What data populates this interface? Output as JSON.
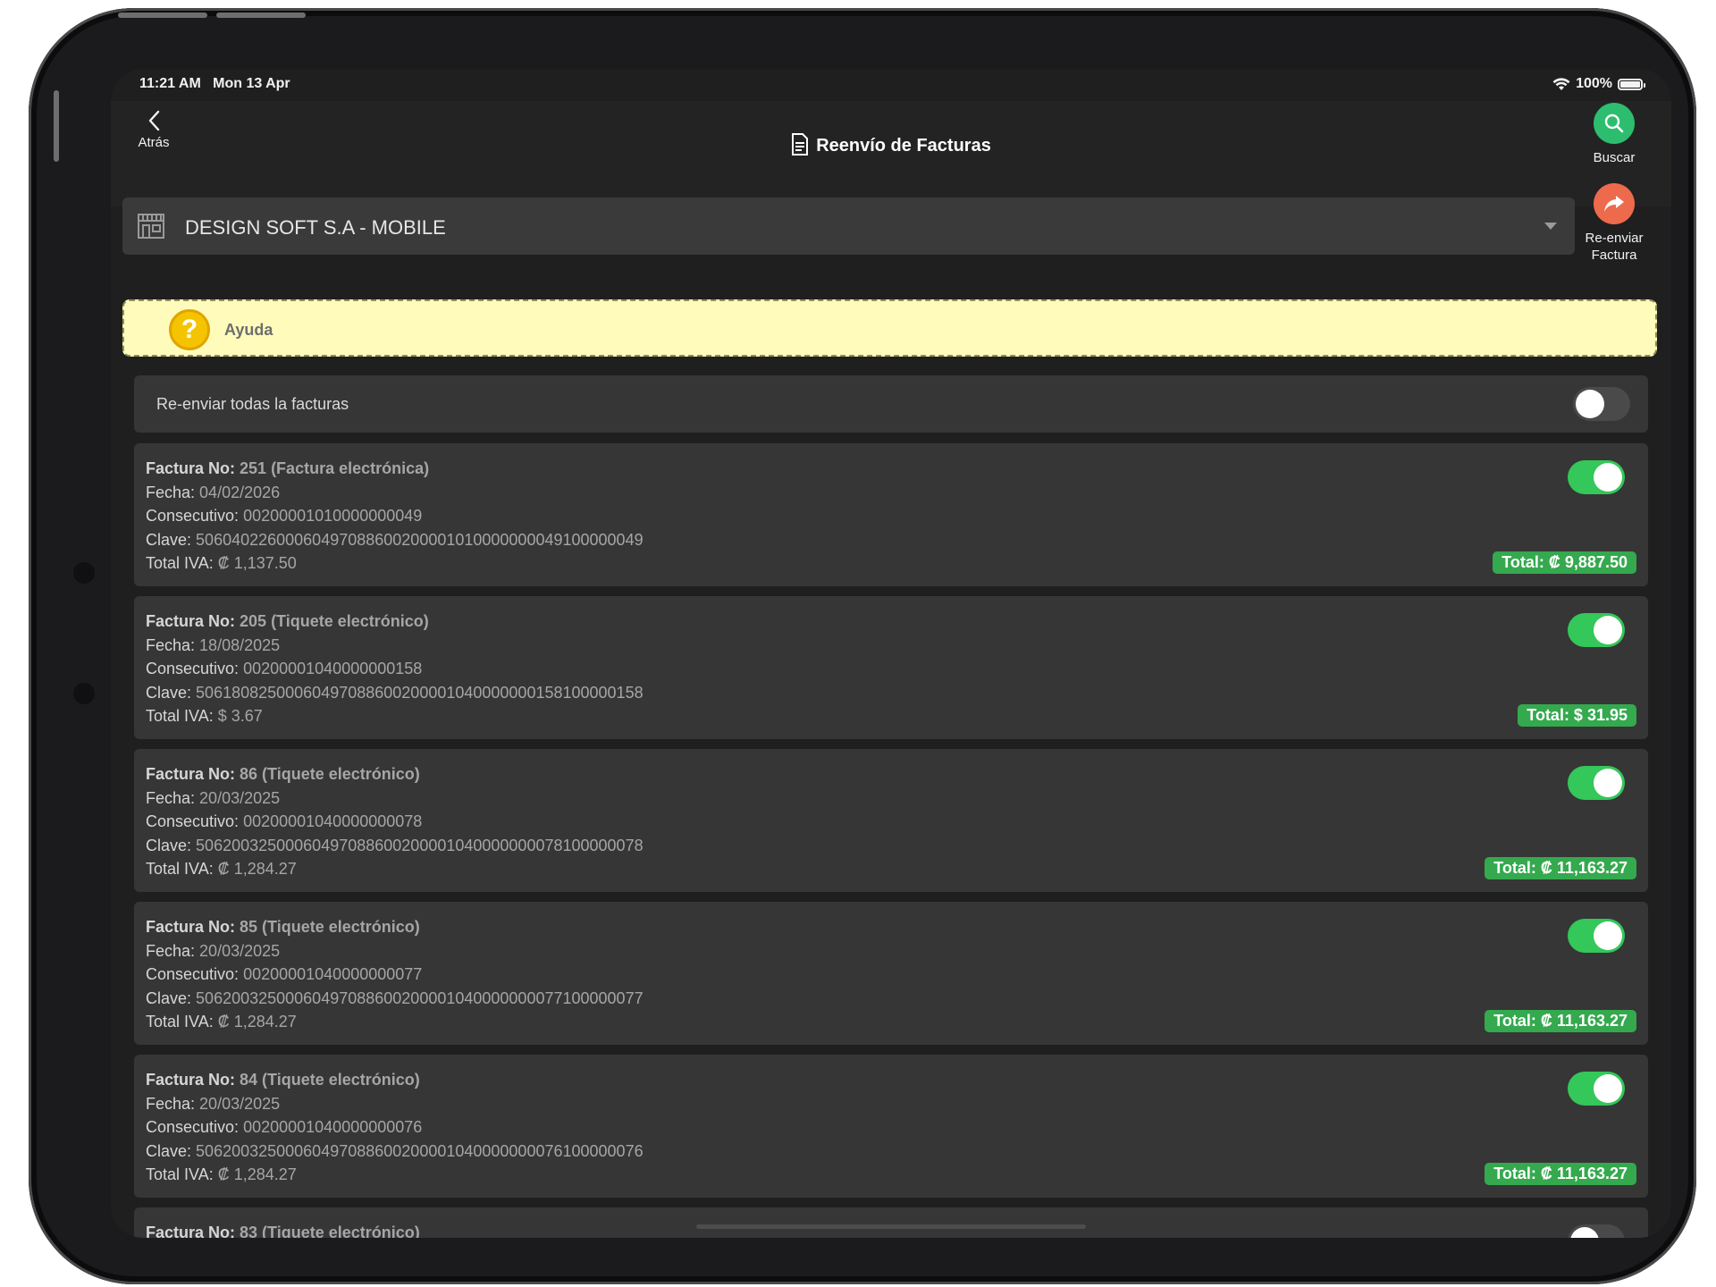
{
  "status_bar": {
    "time": "11:21 AM",
    "date": "Mon 13 Apr",
    "battery": "100%"
  },
  "nav": {
    "back_label": "Atrás",
    "title": "Reenvío de Facturas",
    "search_label": "Buscar",
    "resend_label_1": "Re-enviar",
    "resend_label_2": "Factura"
  },
  "company": {
    "name": "DESIGN SOFT S.A - MOBILE"
  },
  "help": {
    "label": "Ayuda",
    "icon_glyph": "?"
  },
  "resend_all": {
    "label": "Re-enviar todas la facturas",
    "enabled": false
  },
  "labels": {
    "factura_no": "Factura No:",
    "fecha": "Fecha:",
    "consecutivo": "Consecutivo:",
    "clave": "Clave:",
    "total_iva": "Total IVA:"
  },
  "invoices": [
    {
      "number": "251 (Factura electrónica)",
      "date": "04/02/2026",
      "consecutivo": "00200001010000000049",
      "clave": "50604022600060497088600200001010000000049100000049",
      "total_iva": "₡ 1,137.50",
      "total": "Total: ₡ 9,887.50",
      "selected": true
    },
    {
      "number": "205 (Tiquete electrónico)",
      "date": "18/08/2025",
      "consecutivo": "00200001040000000158",
      "clave": "50618082500060497088600200001040000000158100000158",
      "total_iva": "$ 3.67",
      "total": "Total: $ 31.95",
      "selected": true
    },
    {
      "number": "86 (Tiquete electrónico)",
      "date": "20/03/2025",
      "consecutivo": "00200001040000000078",
      "clave": "50620032500060497088600200001040000000078100000078",
      "total_iva": "₡ 1,284.27",
      "total": "Total: ₡ 11,163.27",
      "selected": true
    },
    {
      "number": "85 (Tiquete electrónico)",
      "date": "20/03/2025",
      "consecutivo": "00200001040000000077",
      "clave": "50620032500060497088600200001040000000077100000077",
      "total_iva": "₡ 1,284.27",
      "total": "Total: ₡ 11,163.27",
      "selected": true
    },
    {
      "number": "84 (Tiquete electrónico)",
      "date": "20/03/2025",
      "consecutivo": "00200001040000000076",
      "clave": "50620032500060497088600200001040000000076100000076",
      "total_iva": "₡ 1,284.27",
      "total": "Total: ₡ 11,163.27",
      "selected": true
    },
    {
      "number": "83 (Tiquete electrónico)",
      "selected": false
    }
  ],
  "colors": {
    "accent_green": "#34c759",
    "search_button": "#2dbd6e",
    "resend_button": "#ee6a4c",
    "help_bg": "#fffcbb"
  }
}
